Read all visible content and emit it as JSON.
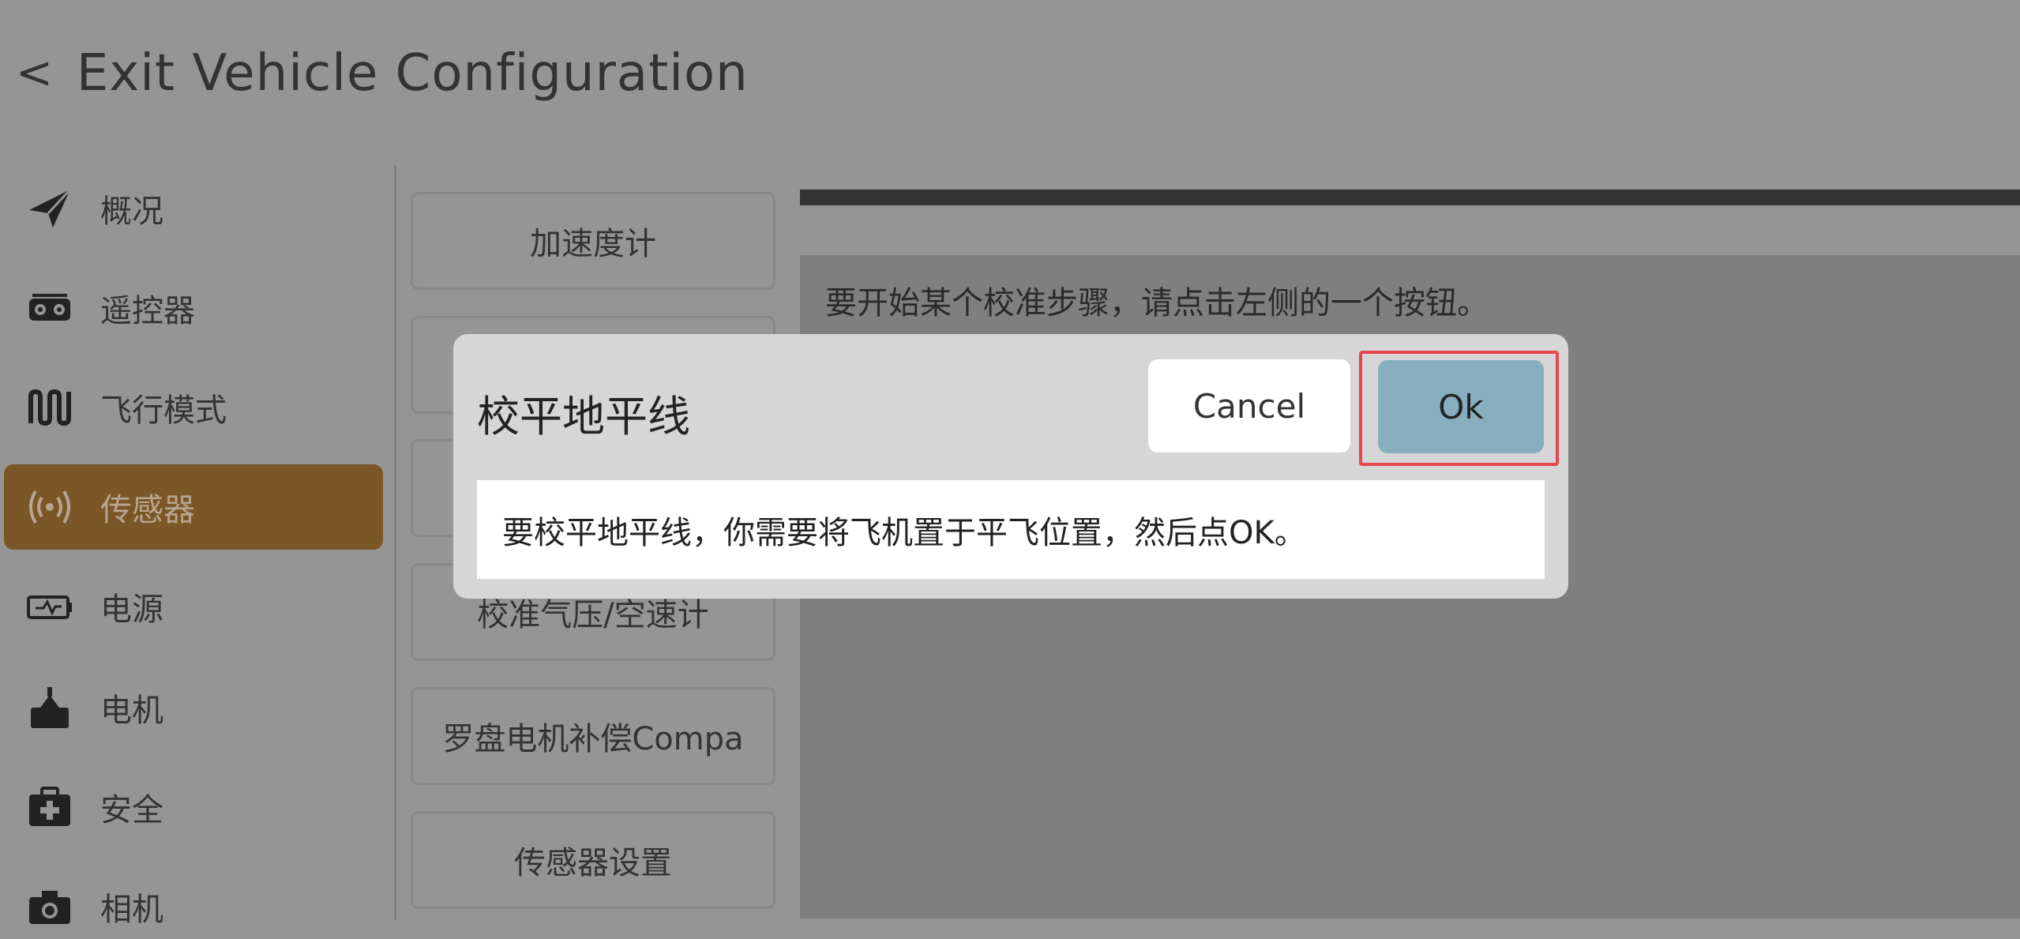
{
  "header": {
    "back_chevron": "<",
    "title": "Exit Vehicle Configuration"
  },
  "sidebar": {
    "items": [
      {
        "label": "概况",
        "icon": "paper-plane-icon",
        "active": false
      },
      {
        "label": "遥控器",
        "icon": "radio-remote-icon",
        "active": false
      },
      {
        "label": "飞行模式",
        "icon": "waveform-icon",
        "active": false
      },
      {
        "label": "传感器",
        "icon": "sensor-wave-icon",
        "active": true
      },
      {
        "label": "电源",
        "icon": "battery-icon",
        "active": false
      },
      {
        "label": "电机",
        "icon": "motor-icon",
        "active": false
      },
      {
        "label": "安全",
        "icon": "first-aid-kit-icon",
        "active": false
      },
      {
        "label": "相机",
        "icon": "camera-icon",
        "active": false
      }
    ]
  },
  "calibration": {
    "buttons": [
      {
        "label": "加速度计"
      },
      {
        "label": ""
      },
      {
        "label": ""
      },
      {
        "label": "校准气压/空速计"
      },
      {
        "label": "罗盘电机补偿Compa"
      },
      {
        "label": "传感器设置"
      }
    ]
  },
  "content": {
    "instruction": "要开始某个校准步骤，请点击左侧的一个按钮。"
  },
  "dialog": {
    "title": "校平地平线",
    "cancel_label": "Cancel",
    "ok_label": "Ok",
    "message": "要校平地平线，你需要将飞机置于平飞位置，然后点OK。"
  },
  "colors": {
    "background": "#959595",
    "active_nav": "#7b5626",
    "ok_button": "#87aebe",
    "highlight": "#e8454d"
  }
}
